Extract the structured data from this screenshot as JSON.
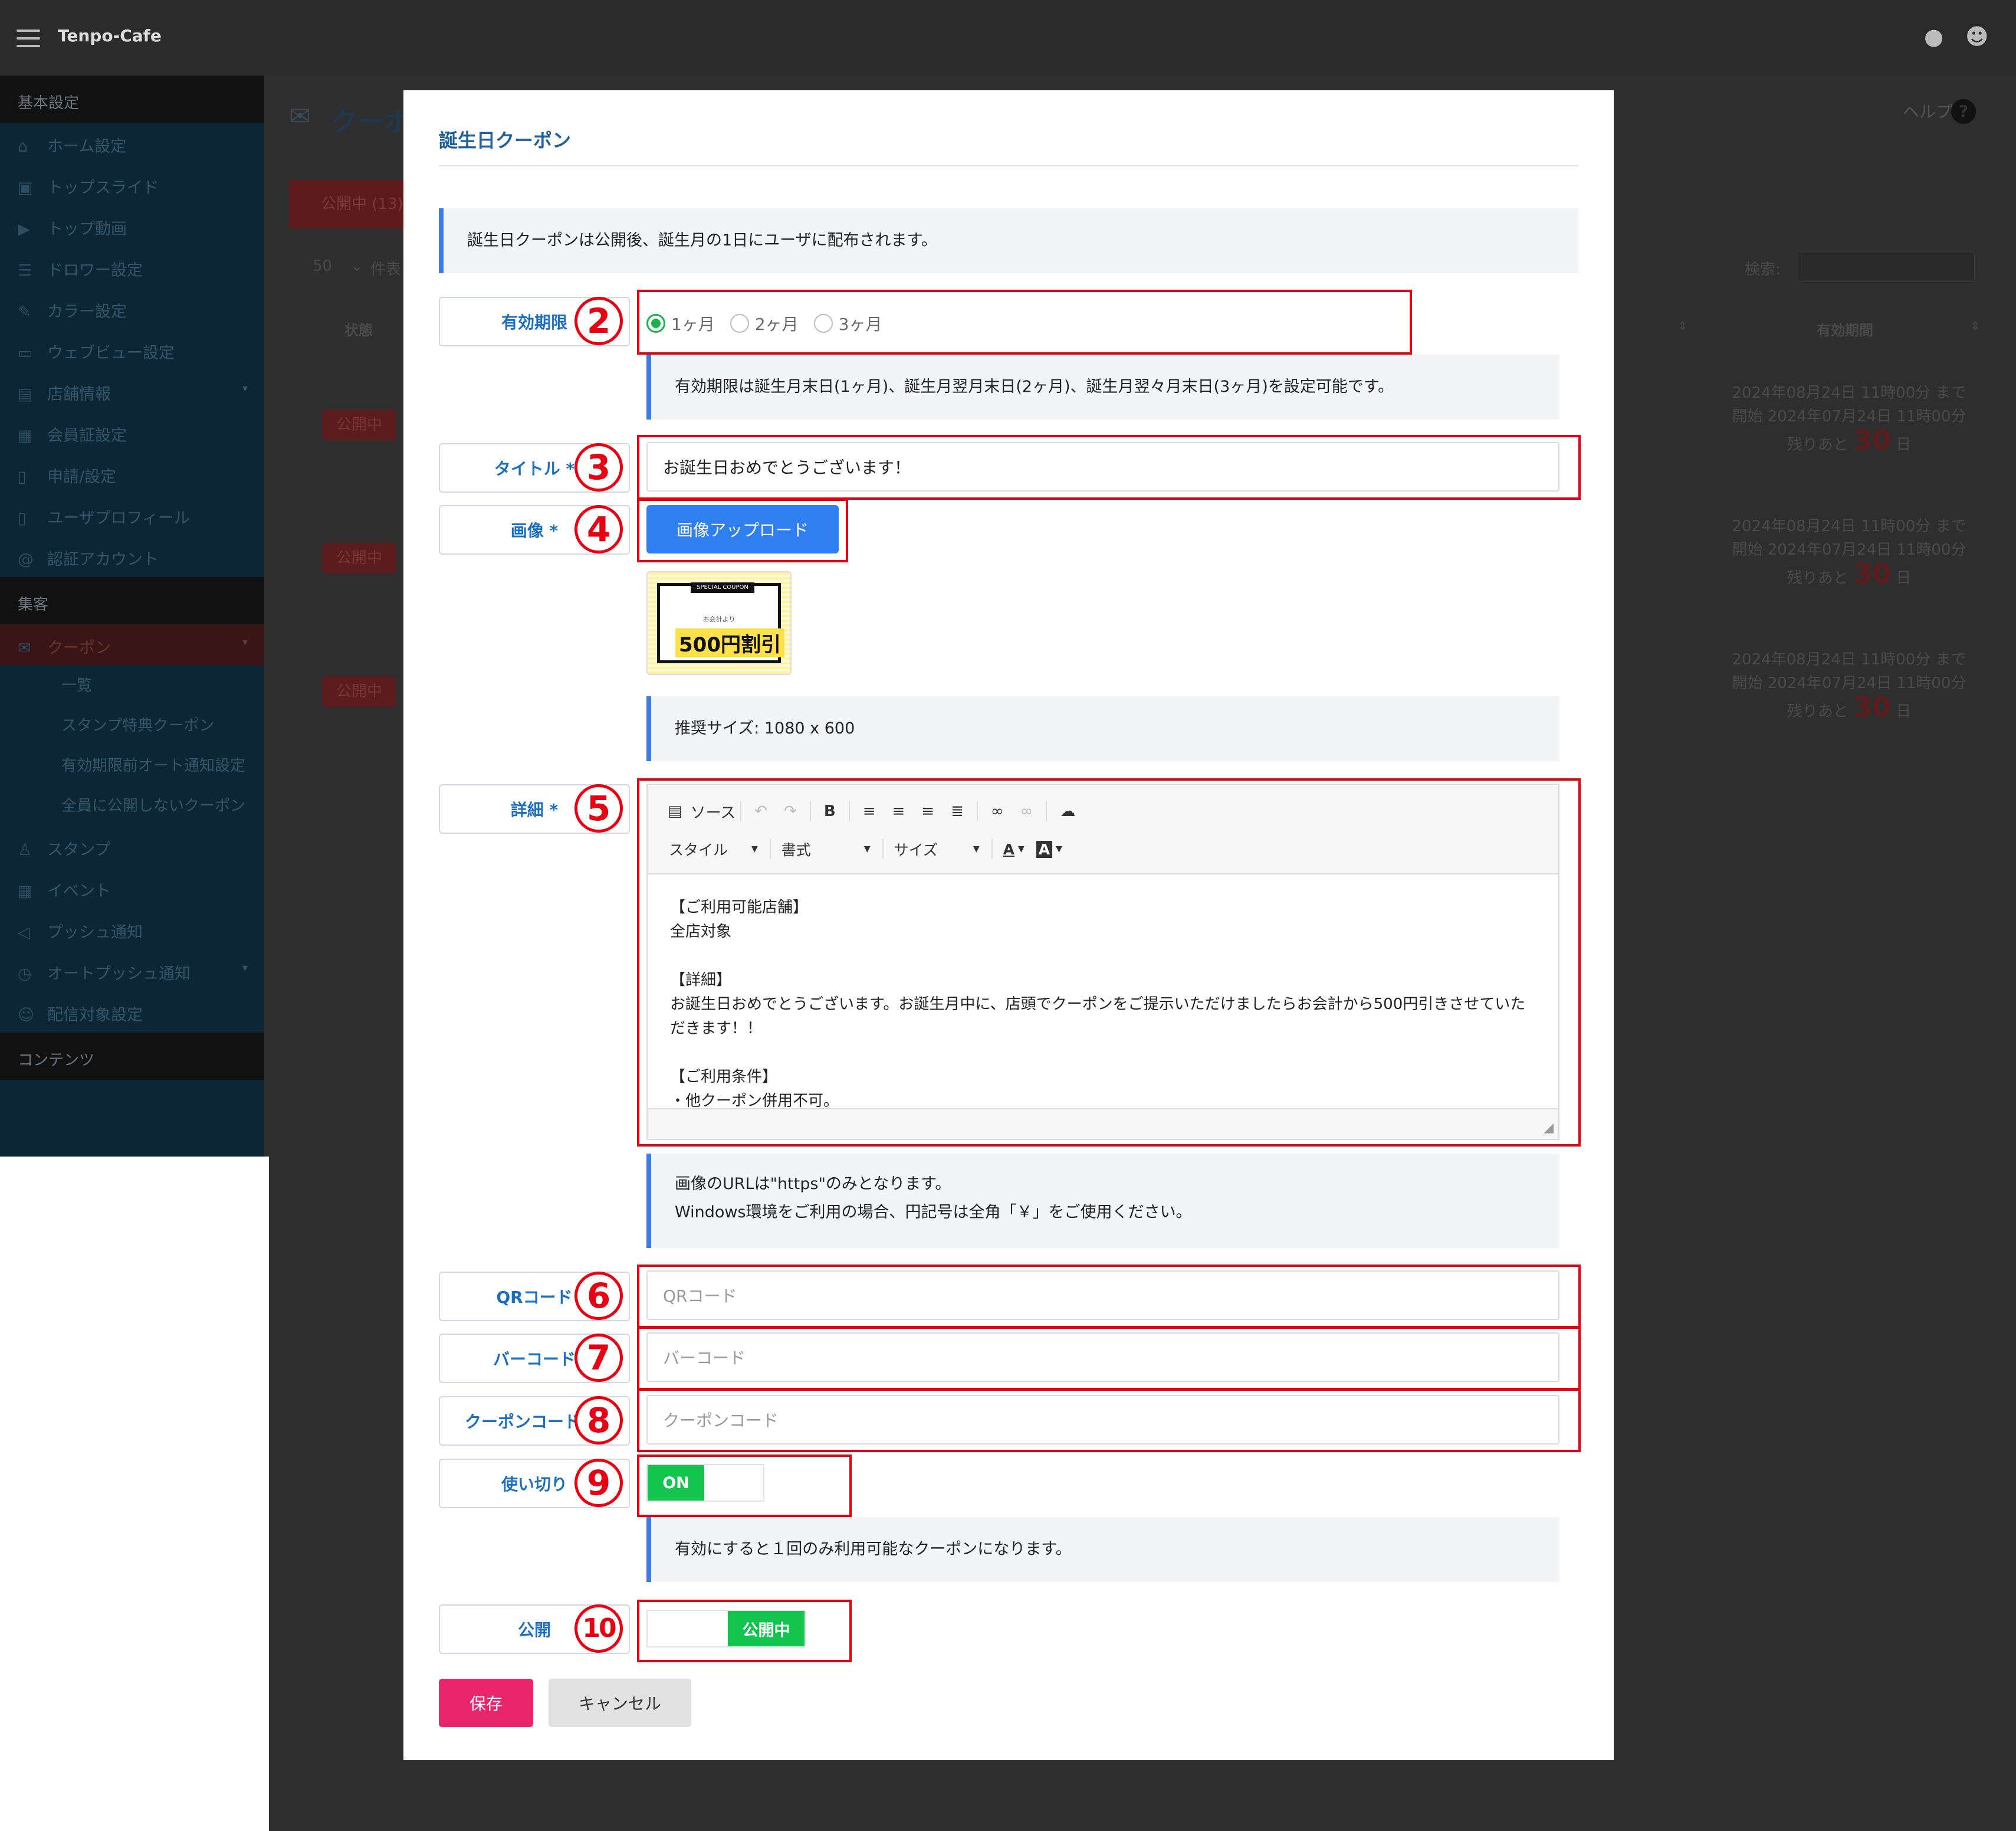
{
  "app": {
    "brand": "Tenpo-Cafe",
    "sidebar": {
      "sections": [
        {
          "title": "基本設定",
          "items": [
            "ホーム設定",
            "トップスライド",
            "トップ動画",
            "ドロワー設定",
            "カラー設定",
            "ウェブビュー設定",
            "店舗情報",
            "会員証設定",
            "申請/設定",
            "ユーザプロフィール",
            "認証アカウント"
          ]
        },
        {
          "title": "集客",
          "items": [
            "クーポン"
          ],
          "sub_items": [
            "一覧",
            "スタンプ特典クーポン",
            "有効期限前オート通知設定",
            "全員に公開しないクーポン"
          ],
          "more_items": [
            "スタンプ",
            "イベント",
            "プッシュ通知",
            "オートプッシュ通知",
            "配信対象設定"
          ]
        },
        {
          "title": "コンテンツ"
        }
      ]
    },
    "page_title": "クーポ",
    "tab_published": "公開中 (13)",
    "per_page": "50",
    "per_page_suffix": "件表",
    "search_label": "検索:",
    "help": "ヘルプ",
    "table": {
      "col_status": "状態",
      "col_validity": "有効期間",
      "rows": [
        {
          "status": "公開中",
          "end": "2024年08月24日 11時00分 まで",
          "start": "開始 2024年07月24日 11時00分",
          "remain_pre": "残りあと",
          "remain_num": "30",
          "remain_unit": "日"
        },
        {
          "status": "公開中",
          "end": "2024年08月24日 11時00分 まで",
          "start": "開始 2024年07月24日 11時00分",
          "remain_pre": "残りあと",
          "remain_num": "30",
          "remain_unit": "日"
        },
        {
          "status": "公開中",
          "end": "2024年08月24日 11時00分 まで",
          "start": "開始 2024年07月24日 11時00分",
          "remain_pre": "残りあと",
          "remain_num": "30",
          "remain_unit": "日"
        }
      ]
    }
  },
  "modal": {
    "title": "誕生日クーポン",
    "notice": "誕生日クーポンは公開後、誕生月の1日にユーザに配布されます。",
    "validity": {
      "label": "有効期限",
      "marker": "2",
      "options": [
        "1ヶ月",
        "2ヶ月",
        "3ヶ月"
      ],
      "selected": "1ヶ月",
      "help": "有効期限は誕生月末日(1ヶ月)、誕生月翌月末日(2ヶ月)、誕生月翌々月末日(3ヶ月)を設定可能です。"
    },
    "title_field": {
      "label": "タイトル *",
      "marker": "3",
      "value": "お誕生日おめでとうございます！"
    },
    "image": {
      "label": "画像 *",
      "marker": "4",
      "upload_label": "画像アップロード",
      "thumb_tag": "SPECIAL COUPON",
      "thumb_sub": "お会計より",
      "thumb_main": "500円割引",
      "help": "推奨サイズ: 1080 x 600"
    },
    "detail": {
      "label": "詳細 *",
      "marker": "5",
      "toolbar_source": "ソース",
      "toolbar_style": "スタイル",
      "toolbar_format": "書式",
      "toolbar_size": "サイズ",
      "body": "【ご利用可能店舗】\n全店対象\n\n【詳細】\nお誕生日おめでとうございます。お誕生月中に、店頭でクーポンをご提示いただけましたらお会計から500円引きさせていた\nだきます！！\n\n【ご利用条件】\n・他クーポン併用不可。",
      "help_line1": "画像のURLは\"https\"のみとなります。",
      "help_line2": "Windows環境をご利用の場合、円記号は全角「￥」をご使用ください。"
    },
    "qr": {
      "label": "QRコード",
      "marker": "6",
      "placeholder": "QRコード"
    },
    "barcode": {
      "label": "バーコード",
      "marker": "7",
      "placeholder": "バーコード"
    },
    "coupon_code": {
      "label": "クーポンコード",
      "marker": "8",
      "placeholder": "クーポンコード"
    },
    "single_use": {
      "label": "使い切り",
      "marker": "9",
      "toggle_text": "ON",
      "help": "有効にすると１回のみ利用可能なクーポンになります。"
    },
    "publish": {
      "label": "公開",
      "marker": "10",
      "toggle_text": "公開中"
    },
    "save_label": "保存",
    "cancel_label": "キャンセル"
  },
  "colors": {
    "accent_blue": "#2f7ff0",
    "label_blue": "#1f6fc1",
    "marker_red": "#e60012",
    "toggle_green": "#13c44f",
    "save_pink": "#e8246b"
  }
}
